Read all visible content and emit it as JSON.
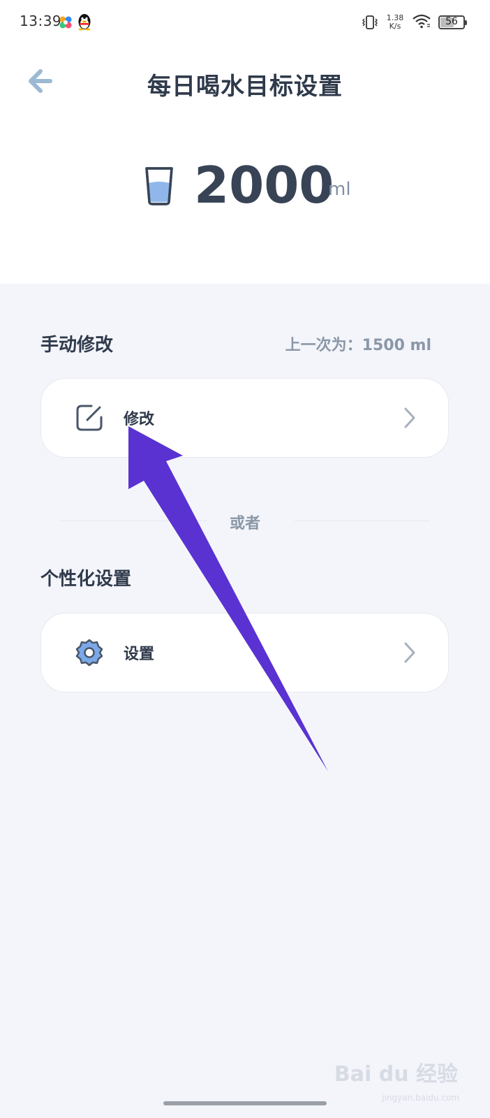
{
  "status_bar": {
    "time": "13:39",
    "net_speed_value": "1.38",
    "net_speed_unit": "K/s",
    "battery": "56"
  },
  "header": {
    "title": "每日喝水目标设置",
    "back_icon": "arrow-left-icon"
  },
  "goal": {
    "value": "2000",
    "unit": "ml",
    "icon": "water-cup-icon"
  },
  "manual_section": {
    "title": "手动修改",
    "last_value": "上一次为：1500 ml",
    "item_label": "修改",
    "item_icon": "edit-icon"
  },
  "divider": {
    "text": "或者"
  },
  "personal_section": {
    "title": "个性化设置",
    "item_label": "设置",
    "item_icon": "gear-icon"
  },
  "watermark": {
    "text": "Bai du 经验",
    "sub": "jingyan.baidu.com"
  },
  "colors": {
    "accent_arrow": "#5a32d1",
    "back_arrow": "#9bb9d3",
    "cup_fill": "#8fb7ec",
    "gear_fill": "#7aa8e8"
  }
}
